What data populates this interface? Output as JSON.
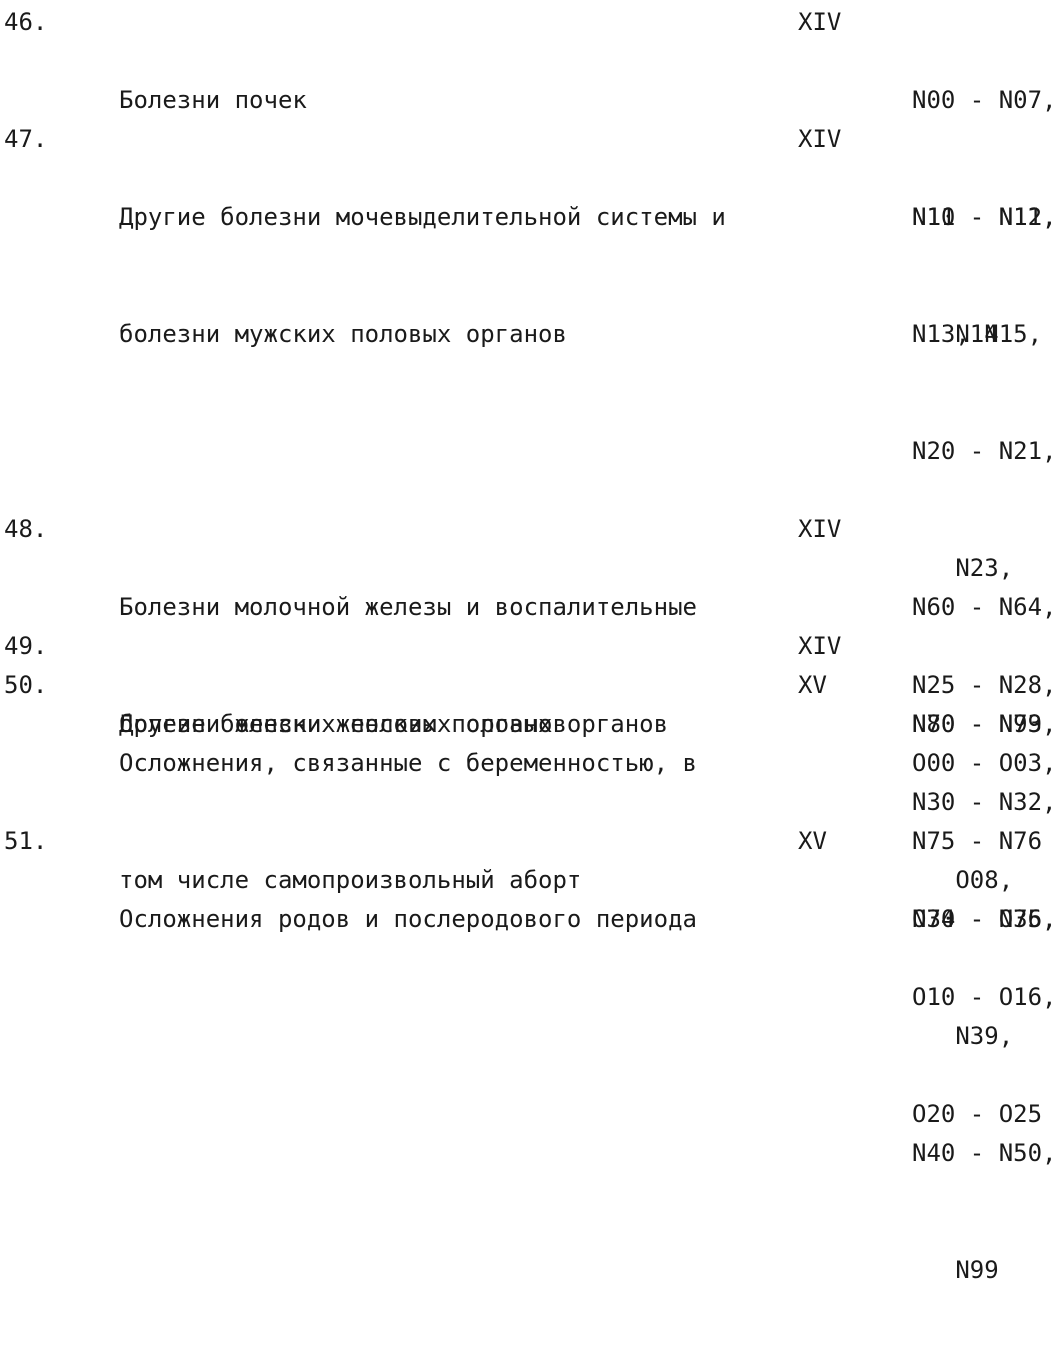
{
  "rows": [
    {
      "num": "46.",
      "name_lines": [
        "Болезни почек"
      ],
      "class": "XIV",
      "code_lines": [
        "N00 - N07,",
        "N11 - N12,",
        "   N14"
      ]
    },
    {
      "num": "47.",
      "name_lines": [
        "Другие болезни мочевыделительной системы и",
        "болезни мужских половых органов"
      ],
      "class": "XIV",
      "code_lines": [
        "N10 - N11,",
        "N13, N15,",
        "N20 - N21,",
        "   N23,",
        "N25 - N28,",
        "N30 - N32,",
        "N34 - N36,",
        "   N39,",
        "N40 - N50,",
        "   N99"
      ]
    },
    {
      "num": "48.",
      "name_lines": [
        "Болезни молочной железы и воспалительные",
        "болезни женских половых органов"
      ],
      "class": "XIV",
      "code_lines": [
        "N60 - N64,",
        "N70 - N73,",
        "N75 - N76"
      ]
    },
    {
      "num": "49.",
      "name_lines": [
        "Другие болезни женских половых органов"
      ],
      "class": "XIV",
      "code_lines": [
        "N80 - N99"
      ]
    },
    {
      "num": "50.",
      "name_lines": [
        "Осложнения, связанные с беременностью, в",
        "том числе самопроизвольный аборт"
      ],
      "class": "XV",
      "code_lines": [
        "O00 - O03,",
        "   O08,",
        "O10 - O16,",
        "O20 - O25"
      ]
    },
    {
      "num": "51.",
      "name_lines": [
        "Осложнения родов и послеродового периода"
      ],
      "class": "XV",
      "code_lines": [
        "O70 - O75,"
      ]
    }
  ]
}
